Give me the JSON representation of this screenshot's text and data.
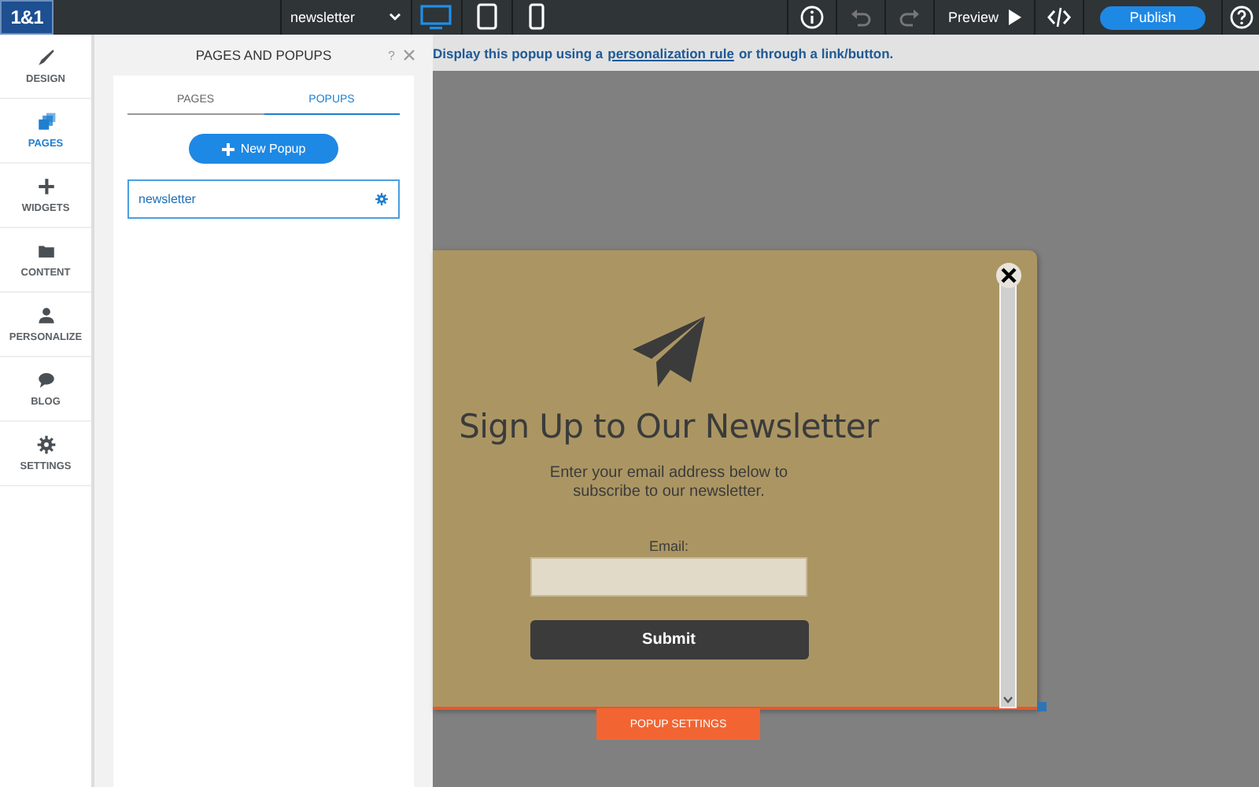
{
  "topbar": {
    "logo": "1&1",
    "page_select": "newsletter",
    "devices": [
      {
        "kind": "desktop",
        "selected": true
      },
      {
        "kind": "tablet",
        "selected": false
      },
      {
        "kind": "phone",
        "selected": false
      }
    ],
    "preview": "Preview",
    "publish": "Publish"
  },
  "nav": [
    {
      "label": "DESIGN",
      "kind": "brush",
      "selected": false
    },
    {
      "label": "PAGES",
      "kind": "pages",
      "selected": true
    },
    {
      "label": "WIDGETS",
      "kind": "plus",
      "selected": false
    },
    {
      "label": "CONTENT",
      "kind": "folder",
      "selected": false
    },
    {
      "label": "PERSONALIZE",
      "kind": "person",
      "selected": false
    },
    {
      "label": "BLOG",
      "kind": "bubble",
      "selected": false
    },
    {
      "label": "SETTINGS",
      "kind": "gear",
      "selected": false
    }
  ],
  "panel": {
    "title": "PAGES AND POPUPS",
    "help": "?",
    "tabs": [
      {
        "label": "PAGES",
        "selected": false
      },
      {
        "label": "POPUPS",
        "selected": true
      }
    ],
    "new_button": "New Popup",
    "items": [
      {
        "name": "newsletter"
      }
    ]
  },
  "hint": {
    "before": "Display this popup using a",
    "link": "personalization rule",
    "after": "or through a link/button."
  },
  "popup": {
    "heading": "Sign Up to Our Newsletter",
    "text": "Enter your email address below to subscribe to our newsletter.",
    "email_label": "Email:",
    "submit": "Submit",
    "settings_tab": "POPUP SETTINGS"
  }
}
